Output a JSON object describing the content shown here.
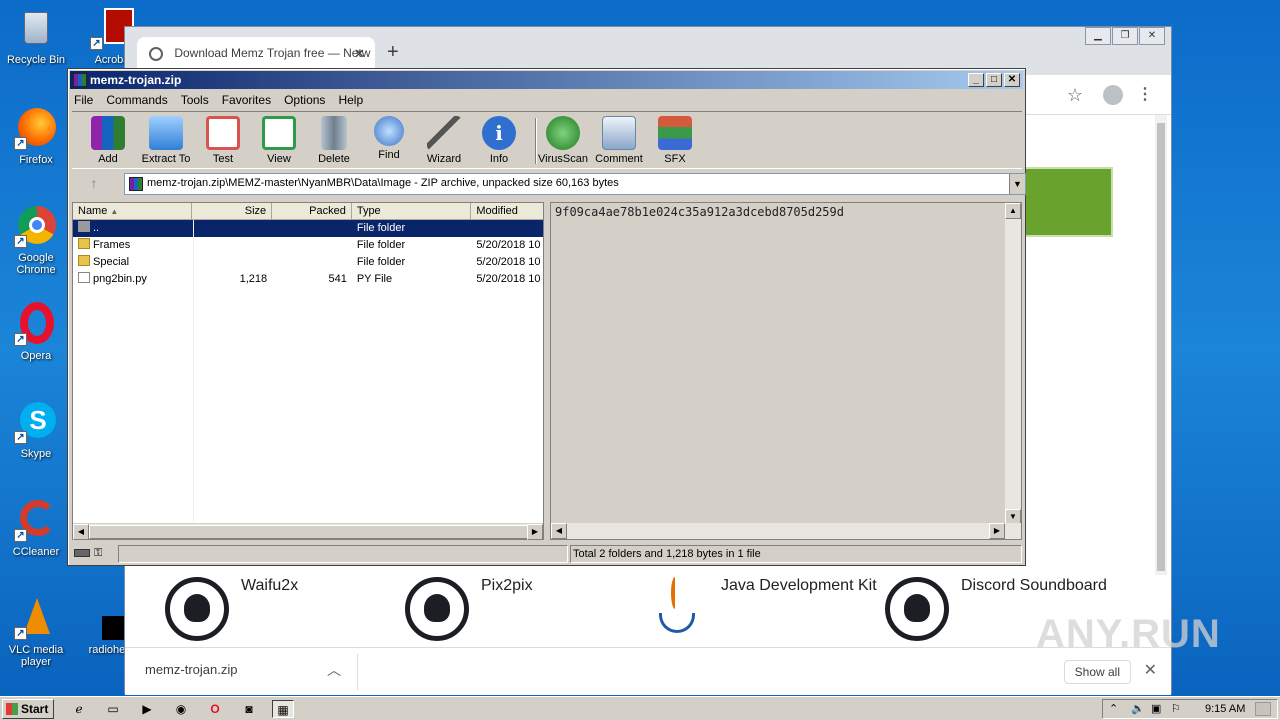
{
  "desktop": {
    "icons": [
      {
        "label": "Recycle Bin"
      },
      {
        "label": "Acroba"
      },
      {
        "label": "Firefox"
      },
      {
        "label": "Google Chrome"
      },
      {
        "label": "Opera"
      },
      {
        "label": "Skype"
      },
      {
        "label": "CCleaner"
      },
      {
        "label": "VLC media player"
      },
      {
        "label": "radiohea"
      }
    ]
  },
  "browser": {
    "tab_title": "Download Memz Trojan free — Netw",
    "tab_close": "✕",
    "new_tab": "+",
    "apps": [
      {
        "name": "Waifu2x"
      },
      {
        "name": "Pix2pix"
      },
      {
        "name": "Java Development Kit"
      },
      {
        "name": "Discord Soundboard"
      }
    ],
    "download": {
      "filename": "memz-trojan.zip",
      "show_all": "Show all"
    }
  },
  "winrar": {
    "title": "memz-trojan.zip",
    "menu": [
      "File",
      "Commands",
      "Tools",
      "Favorites",
      "Options",
      "Help"
    ],
    "toolbar": [
      {
        "label": "Add",
        "icon": "add-icon",
        "color": "#c0392b"
      },
      {
        "label": "Extract To",
        "icon": "extract-folder-icon",
        "color": "#3a8ee6"
      },
      {
        "label": "Test",
        "icon": "test-clipboard-icon",
        "color": "#d9534f"
      },
      {
        "label": "View",
        "icon": "view-book-icon",
        "color": "#2e9a4a"
      },
      {
        "label": "Delete",
        "icon": "trash-icon",
        "color": "#8a9aa8"
      },
      {
        "label": "Find",
        "icon": "magnifier-icon",
        "color": "#3b74c7"
      },
      {
        "label": "Wizard",
        "icon": "magic-wand-icon",
        "color": "#9bbd3a"
      },
      {
        "label": "Info",
        "icon": "info-icon",
        "color": "#2f6fd0"
      },
      {
        "label": "VirusScan",
        "icon": "virus-scan-icon",
        "color": "#2f9a2f"
      },
      {
        "label": "Comment",
        "icon": "comment-icon",
        "color": "#8aa6c8"
      },
      {
        "label": "SFX",
        "icon": "sfx-books-icon",
        "color": "#d35a3a"
      }
    ],
    "path": "memz-trojan.zip\\MEMZ-master\\NyanMBR\\Data\\Image - ZIP archive, unpacked size 60,163 bytes",
    "columns": [
      "Name",
      "Size",
      "Packed",
      "Type",
      "Modified"
    ],
    "rows": [
      {
        "name": "..",
        "size": "",
        "packed": "",
        "type": "File folder",
        "modified": "",
        "kind": "updir"
      },
      {
        "name": "Frames",
        "size": "",
        "packed": "",
        "type": "File folder",
        "modified": "5/20/2018 10",
        "kind": "folder"
      },
      {
        "name": "Special",
        "size": "",
        "packed": "",
        "type": "File folder",
        "modified": "5/20/2018 10",
        "kind": "folder"
      },
      {
        "name": "png2bin.py",
        "size": "1,218",
        "packed": "541",
        "type": "PY File",
        "modified": "5/20/2018 10",
        "kind": "file"
      }
    ],
    "preview_text": "9f09ca4ae78b1e024c35a912a3dcebd8705d259d",
    "status": "Total 2 folders and 1,218 bytes in 1 file"
  },
  "taskbar": {
    "start": "Start",
    "time": "9:15 AM"
  },
  "watermark": "ANY.RUN"
}
